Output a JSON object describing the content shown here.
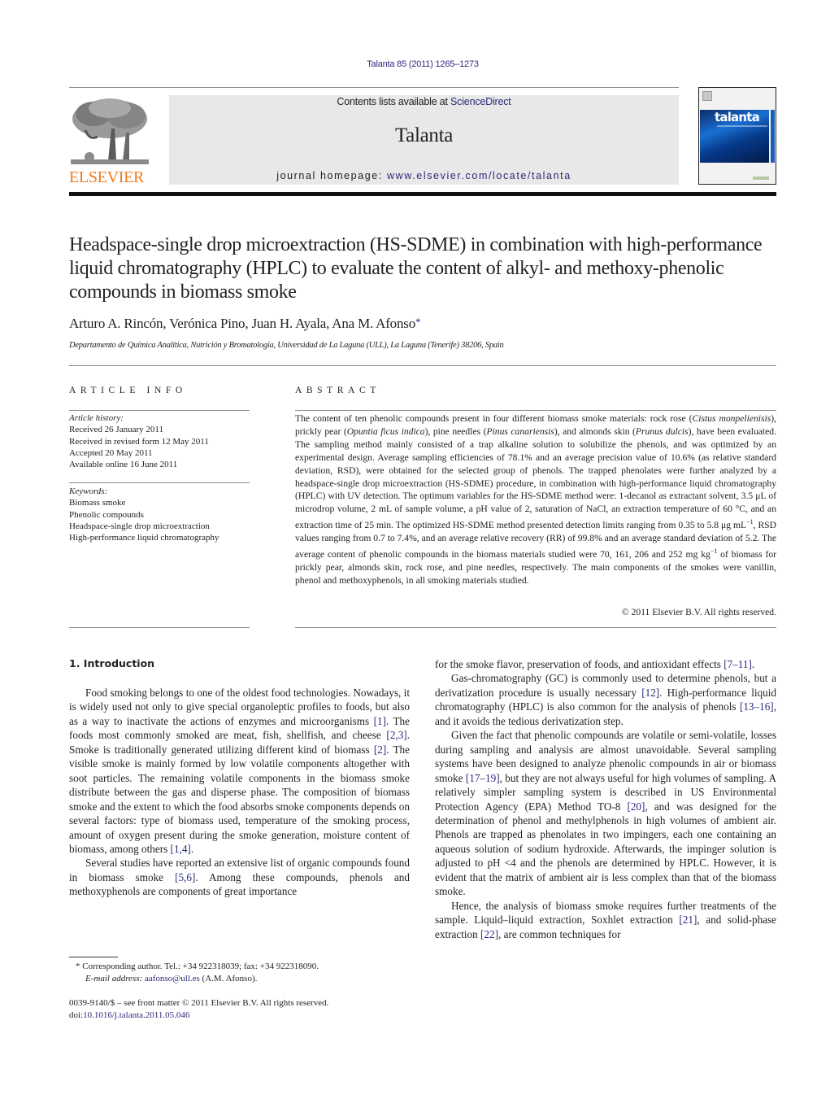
{
  "header": {
    "citation": "Talanta 85 (2011) 1265–1273",
    "contents_prefix": "Contents lists available at ",
    "contents_link": "ScienceDirect",
    "journal_name": "Talanta",
    "homepage_prefix": "journal homepage: ",
    "homepage_url": "www.elsevier.com/locate/talanta",
    "publisher_logo_text": "ELSEVIER",
    "cover_title": "talanta",
    "colors": {
      "link": "#2a2a7c",
      "elsevier_orange": "#f07b1c",
      "masthead_bg": "#e8e8e8"
    }
  },
  "article": {
    "title": "Headspace-single drop microextraction (HS-SDME) in combination with high-performance liquid chromatography (HPLC) to evaluate the content of alkyl- and methoxy-phenolic compounds in biomass smoke",
    "authors": "Arturo A. Rincón, Verónica Pino, Juan H. Ayala, Ana M. Afonso",
    "corresponding_mark": "*",
    "affiliation": "Departamento de Química Analítica, Nutrición y Bromatología, Universidad de La Laguna (ULL), La Laguna (Tenerife) 38206, Spain"
  },
  "article_info": {
    "heading": "ARTICLE INFO",
    "history_label": "Article history:",
    "history": [
      "Received 26 January 2011",
      "Received in revised form 12 May 2011",
      "Accepted 20 May 2011",
      "Available online 16 June 2011"
    ],
    "keywords_label": "Keywords:",
    "keywords": [
      "Biomass smoke",
      "Phenolic compounds",
      "Headspace-single drop microextraction",
      "High-performance liquid chromatography"
    ]
  },
  "abstract": {
    "heading": "ABSTRACT",
    "parts": {
      "p1": "The content of ten phenolic compounds present in four different biomass smoke materials: rock rose (",
      "i1": "Cistus monpelienisis",
      "p2": "), prickly pear (",
      "i2": "Opuntia ficus indica",
      "p3": "), pine needles (",
      "i3": "Pinus canariensis",
      "p4": "), and almonds skin (",
      "i4": "Prunus dulcis",
      "p5": "), have been evaluated. The sampling method mainly consisted of a trap alkaline solution to solubilize the phenols, and was optimized by an experimental design. Average sampling efficiencies of 78.1% and an average precision value of 10.6% (as relative standard deviation, RSD), were obtained for the selected group of phenols. The trapped phenolates were further analyzed by a headspace-single drop microextraction (HS-SDME) procedure, in combination with high-performance liquid chromatography (HPLC) with UV detection. The optimum variables for the HS-SDME method were: 1-decanol as extractant solvent, 3.5 μL of microdrop volume, 2 mL of sample volume, a pH value of 2, saturation of NaCl, an extraction temperature of 60 °C, and an extraction time of 25 min. The optimized HS-SDME method presented detection limits ranging from 0.35 to 5.8 μg mL",
      "sup1": "−1",
      "p6": ", RSD values ranging from 0.7 to 7.4%, and an average relative recovery (RR) of 99.8% and an average standard deviation of 5.2. The average content of phenolic compounds in the biomass materials studied were 70, 161, 206 and 252 mg kg",
      "sup2": "−1",
      "p7": " of biomass for prickly pear, almonds skin, rock rose, and pine needles, respectively. The main components of the smokes were vanillin, phenol and methoxyphenols, in all smoking materials studied."
    },
    "copyright": "© 2011 Elsevier B.V. All rights reserved."
  },
  "body": {
    "section_heading": "1.  Introduction",
    "left": {
      "p1": {
        "t1": "Food smoking belongs to one of the oldest food technologies. Nowadays, it is widely used not only to give special organoleptic profiles to foods, but also as a way to inactivate the actions of enzymes and microorganisms ",
        "r1": "[1]",
        "t2": ". The foods most commonly smoked are meat, fish, shellfish, and cheese ",
        "r2": "[2,3]",
        "t3": ". Smoke is traditionally generated utilizing different kind of biomass ",
        "r3": "[2]",
        "t4": ". The visible smoke is mainly formed by low volatile components altogether with soot particles. The remaining volatile components in the biomass smoke distribute between the gas and disperse phase. The composition of biomass smoke and the extent to which the food absorbs smoke components depends on several factors: type of biomass used, temperature of the smoking process, amount of oxygen present during the smoke generation, moisture content of biomass, among others ",
        "r4": "[1,4]",
        "t5": "."
      },
      "p2": {
        "t1": "Several studies have reported an extensive list of organic compounds found in biomass smoke ",
        "r1": "[5,6]",
        "t2": ". Among these compounds, phenols and methoxyphenols are components of great importance"
      }
    },
    "right": {
      "p0": {
        "t1": "for the smoke flavor, preservation of foods, and antioxidant effects ",
        "r1": "[7–11]",
        "t2": "."
      },
      "p1": {
        "t1": "Gas-chromatography (GC) is commonly used to determine phenols, but a derivatization procedure is usually necessary ",
        "r1": "[12]",
        "t2": ". High-performance liquid chromatography (HPLC) is also common for the analysis of phenols ",
        "r2": "[13–16]",
        "t3": ", and it avoids the tedious derivatization step."
      },
      "p2": {
        "t1": "Given the fact that phenolic compounds are volatile or semi-volatile, losses during sampling and analysis are almost unavoidable. Several sampling systems have been designed to analyze phenolic compounds in air or biomass smoke ",
        "r1": "[17–19]",
        "t2": ", but they are not always useful for high volumes of sampling. A relatively simpler sampling system is described in US Environmental Protection Agency (EPA) Method TO-8 ",
        "r2": "[20]",
        "t3": ", and was designed for the determination of phenol and methylphenols in high volumes of ambient air. Phenols are trapped as phenolates in two impingers, each one containing an aqueous solution of sodium hydroxide. Afterwards, the impinger solution is adjusted to pH <4 and the phenols are determined by HPLC. However, it is evident that the matrix of ambient air is less complex than that of the biomass smoke."
      },
      "p3": {
        "t1": "Hence, the analysis of biomass smoke requires further treatments of the sample. Liquid–liquid extraction, Soxhlet extraction ",
        "r1": "[21]",
        "t2": ", and solid-phase extraction ",
        "r2": "[22]",
        "t3": ", are common techniques for"
      }
    }
  },
  "footnote": {
    "mark": "*",
    "corresponding": " Corresponding author. Tel.: +34 922318039; fax: +34 922318090.",
    "email_label": "E-mail address:",
    "email": "aafonso@ull.es",
    "email_suffix": " (A.M. Afonso)."
  },
  "front_matter": {
    "issn_line": "0039-9140/$ – see front matter © 2011 Elsevier B.V. All rights reserved.",
    "doi_prefix": "doi:",
    "doi": "10.1016/j.talanta.2011.05.046"
  }
}
